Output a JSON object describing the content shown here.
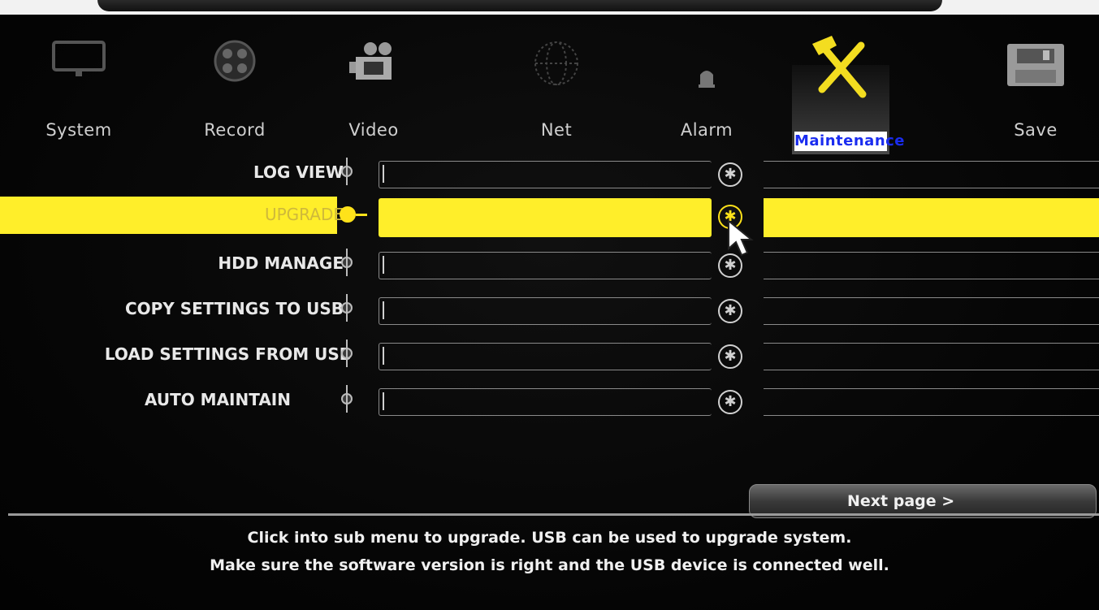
{
  "tabs": [
    {
      "label": "System",
      "icon": "monitor-icon"
    },
    {
      "label": "Record",
      "icon": "film-reel-icon"
    },
    {
      "label": "Video",
      "icon": "video-camera-icon"
    },
    {
      "label": "Net",
      "icon": "globe-icon"
    },
    {
      "label": "Alarm",
      "icon": "alarm-bell-icon"
    },
    {
      "label": "Maintenance",
      "icon": "wrench-screwdriver-icon",
      "active": true
    },
    {
      "label": "Save",
      "icon": "floppy-disk-icon"
    }
  ],
  "menu": {
    "items": [
      {
        "label": "LOG VIEW",
        "icon": "settings-gear-icon"
      },
      {
        "label": "UPGRADE",
        "icon": "settings-gear-icon",
        "selected": true
      },
      {
        "label": "HDD MANAGE",
        "icon": "settings-gear-icon"
      },
      {
        "label": "COPY SETTINGS TO USB",
        "icon": "settings-gear-icon"
      },
      {
        "label": "LOAD SETTINGS FROM USB",
        "icon": "settings-gear-icon"
      },
      {
        "label": "AUTO MAINTAIN",
        "icon": "settings-gear-icon"
      }
    ]
  },
  "buttons": {
    "next_page": "Next page  >"
  },
  "help": {
    "line1": "Click into sub menu to upgrade. USB can be used to upgrade system.",
    "line2": "Make sure the software version is right and the USB device is connected well."
  },
  "colors": {
    "highlight": "#ffee2a",
    "active_tab_text": "#1a2cf0",
    "background": "#070707"
  }
}
